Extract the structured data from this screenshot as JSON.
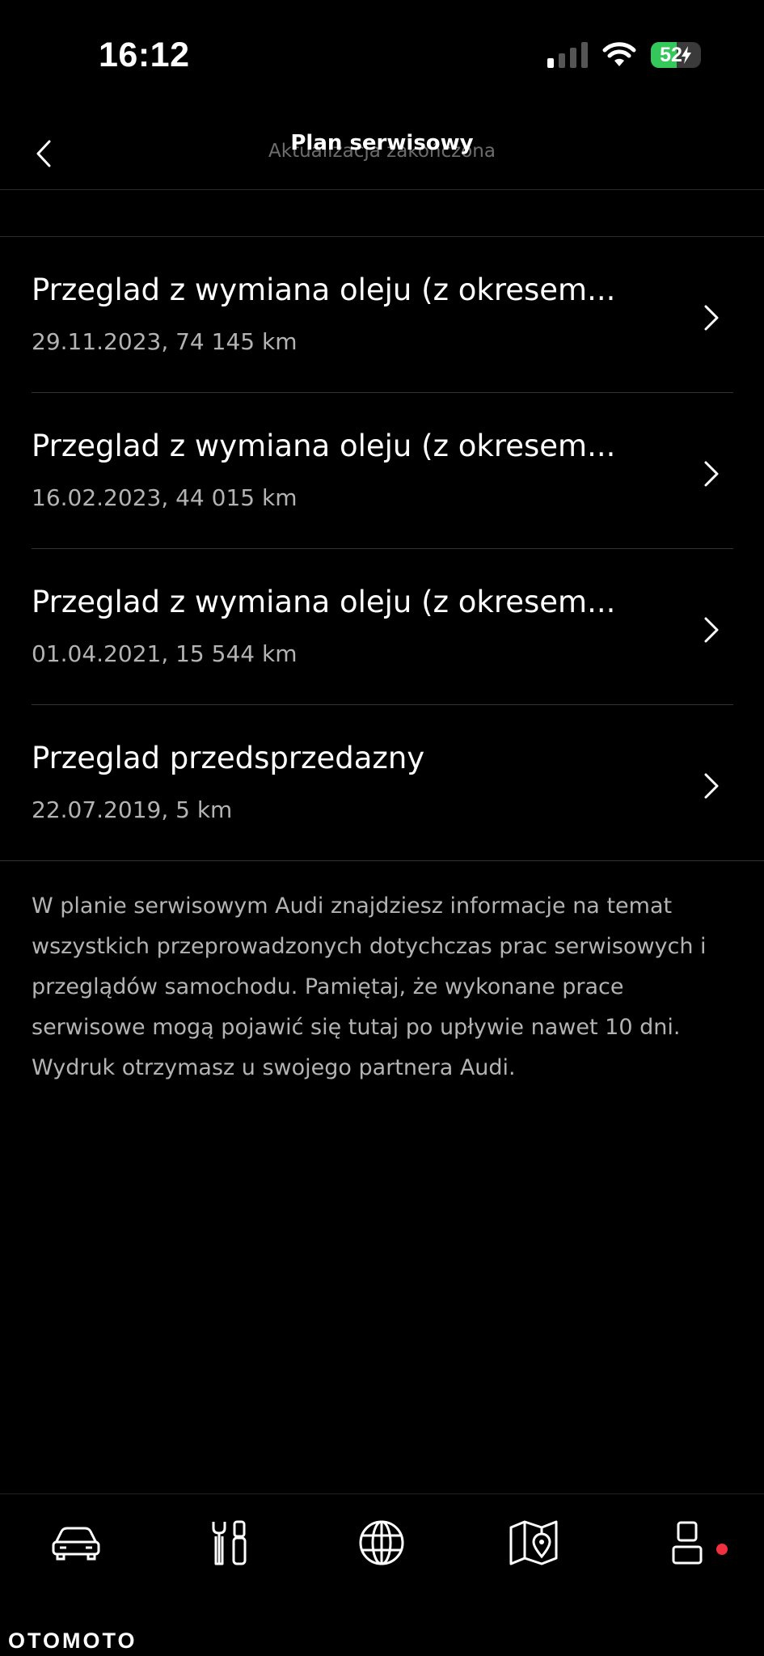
{
  "status_bar": {
    "time": "16:12",
    "battery_level": "52",
    "signal_bars_active": 1,
    "signal_bars_total": 4,
    "icons": [
      "cellular-signal-icon",
      "wifi-icon",
      "battery-charging-icon"
    ]
  },
  "header": {
    "title": "Plan serwisowy",
    "subtitle": "Aktualizacja zakończona",
    "back_icon": "chevron-left-icon"
  },
  "service_entries": [
    {
      "title": "Przeglad z wymiana oleju (z okresem...",
      "details": "29.11.2023, 74 145 km"
    },
    {
      "title": "Przeglad z wymiana oleju (z okresem...",
      "details": "16.02.2023, 44 015 km"
    },
    {
      "title": "Przeglad z wymiana oleju (z okresem...",
      "details": "01.04.2021, 15 544 km"
    },
    {
      "title": "Przeglad przedsprzedazny",
      "details": "22.07.2019, 5 km"
    }
  ],
  "info_text": "W planie serwisowym Audi znajdziesz informacje na temat wszystkich przeprowadzonych dotychczas prac serwisowych i przeglądów samochodu. Pamiętaj, że wykonane prace serwisowe mogą pojawić się tutaj po upływie nawet 10 dni. Wydruk otrzymasz u swojego partnera Audi.",
  "tab_bar": {
    "tabs": [
      {
        "icon": "car-icon"
      },
      {
        "icon": "service-tools-icon"
      },
      {
        "icon": "globe-icon"
      },
      {
        "icon": "map-pin-icon"
      },
      {
        "icon": "profile-icon",
        "has_notification": true
      }
    ],
    "notification_color": "#f0303e"
  },
  "watermark": "OTOMOTO"
}
